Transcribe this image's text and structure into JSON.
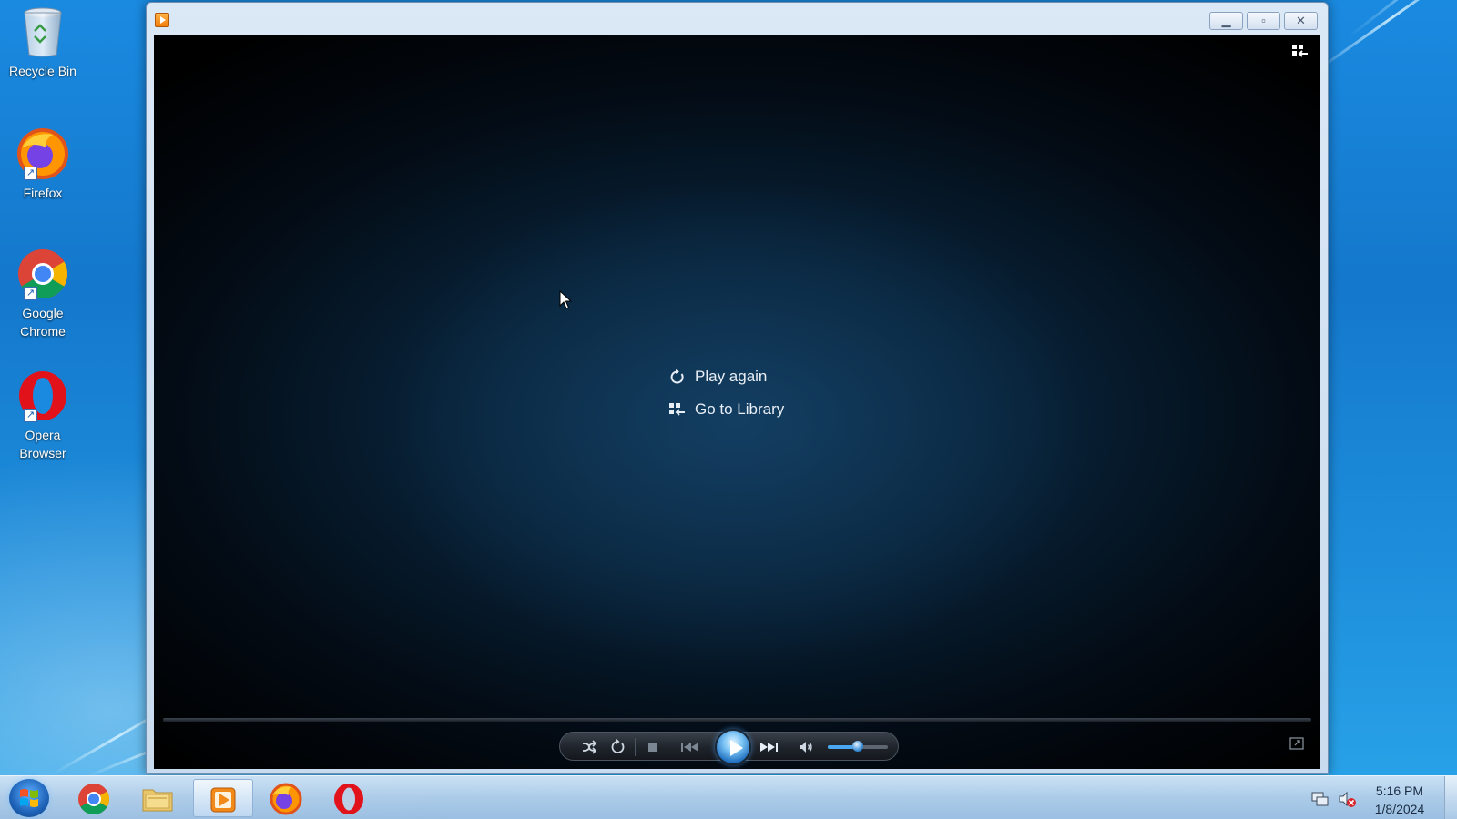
{
  "desktop": {
    "icons": [
      {
        "label": "Recycle Bin",
        "icon": "recycle-bin-icon"
      },
      {
        "label": "Firefox",
        "icon": "firefox-icon"
      },
      {
        "label": "Google Chrome",
        "icon": "chrome-icon"
      },
      {
        "label": "Opera Browser",
        "icon": "opera-icon"
      }
    ]
  },
  "player": {
    "window_icon": "media-player-icon",
    "caption_buttons": {
      "minimize": "▁",
      "maximize": "▫",
      "close": "✕"
    },
    "center_actions": {
      "play_again": "Play again",
      "go_to_library": "Go to Library"
    },
    "controls": {
      "shuffle": "shuffle-icon",
      "repeat": "repeat-icon",
      "stop": "stop-icon",
      "previous": "previous-icon",
      "play": "play-icon",
      "next": "next-icon",
      "mute": "speaker-icon",
      "volume_level": 0.5,
      "fullscreen": "fullscreen-icon",
      "switch_to_library": "switch-to-library-icon"
    },
    "accent_color": "#3d8fd8"
  },
  "taskbar": {
    "pinned": [
      "chrome-icon",
      "file-explorer-icon",
      "media-player-icon",
      "firefox-icon",
      "opera-icon"
    ],
    "active": "media-player-icon",
    "tray": {
      "network": "network-icon",
      "volume": "volume-muted-icon"
    },
    "clock": {
      "time": "5:16 PM",
      "date": "1/8/2024"
    }
  }
}
